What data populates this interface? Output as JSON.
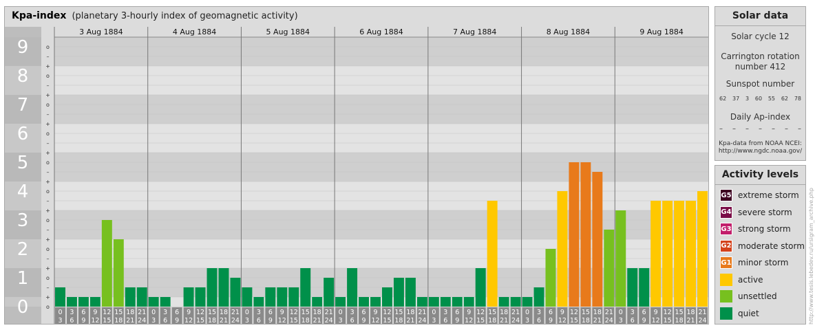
{
  "chart_data": {
    "type": "bar",
    "title": "Kpa-index",
    "subtitle": "(planetary 3-hourly index of geomagnetic activity)",
    "ylim": [
      0,
      9
    ],
    "y_ticks": [
      "0",
      "1",
      "2",
      "3",
      "4",
      "5",
      "6",
      "7",
      "8",
      "9"
    ],
    "y_subticks": [
      "o",
      "+",
      "–",
      "o"
    ],
    "days": [
      "3 Aug 1884",
      "4 Aug 1884",
      "5 Aug 1884",
      "6 Aug 1884",
      "7 Aug 1884",
      "8 Aug 1884",
      "9 Aug 1884"
    ],
    "interval_top": [
      "0",
      "3",
      "6",
      "9",
      "12",
      "15",
      "18",
      "21"
    ],
    "interval_bottom": [
      "3",
      "6",
      "9",
      "12",
      "15",
      "18",
      "21",
      "24"
    ],
    "series": [
      {
        "values": [
          0.667,
          0.333,
          0.333,
          0.333,
          3.0,
          2.333,
          0.667,
          0.667,
          0.333,
          0.333,
          0.0,
          0.667,
          0.667,
          1.333,
          1.333,
          1.0,
          0.667,
          0.333,
          0.667,
          0.667,
          0.667,
          1.333,
          0.333,
          1.0,
          0.333,
          1.333,
          0.333,
          0.333,
          0.667,
          1.0,
          1.0,
          0.333,
          0.333,
          0.333,
          0.333,
          0.333,
          1.333,
          3.667,
          0.333,
          0.333,
          0.333,
          0.667,
          2.0,
          4.0,
          5.0,
          5.0,
          4.667,
          2.667,
          3.333,
          1.333,
          1.333,
          3.667,
          3.667,
          3.667,
          3.667,
          4.0
        ]
      }
    ],
    "colors": {
      "quiet": "#00904a",
      "unsettled": "#77c01f",
      "active": "#ffc800",
      "G1": "#e87a1b",
      "G2": "#d4421b",
      "G3": "#c21e6b",
      "G4": "#7a0c47",
      "G5": "#3d0020"
    },
    "grid": true
  },
  "solar": {
    "title": "Solar data",
    "cycle": "Solar cycle 12",
    "carrington_line1": "Carrington rotation",
    "carrington_line2": "number 412",
    "sunspot_label": "Sunspot number",
    "sunspot_values": [
      "62",
      "37",
      "3",
      "60",
      "55",
      "62",
      "78"
    ],
    "ap_label": "Daily Ap-index",
    "ap_values": [
      "–",
      "–",
      "–",
      "–",
      "–",
      "–",
      "–"
    ],
    "source_line1": "Kpa-data from NOAA NCEI:",
    "source_line2": "http://www.ngdc.noaa.gov/"
  },
  "activity": {
    "title": "Activity levels",
    "items": [
      {
        "code": "G5",
        "label": "extreme storm",
        "color": "#3d0020"
      },
      {
        "code": "G4",
        "label": "severe storm",
        "color": "#7a0c47"
      },
      {
        "code": "G3",
        "label": "strong storm",
        "color": "#c21e6b"
      },
      {
        "code": "G2",
        "label": "moderate storm",
        "color": "#d4421b"
      },
      {
        "code": "G1",
        "label": "minor storm",
        "color": "#e87a1b"
      },
      {
        "code": "",
        "label": "active",
        "color": "#ffc800"
      },
      {
        "code": "",
        "label": "unsettled",
        "color": "#77c01f"
      },
      {
        "code": "",
        "label": "quiet",
        "color": "#00904a"
      }
    ]
  },
  "credit": "http://www.tesis.lebedev.ru/ursigram_archive.php"
}
